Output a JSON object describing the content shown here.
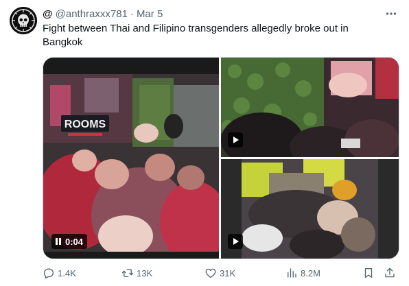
{
  "author": {
    "display_name": "@",
    "handle": "@anthraxxx781",
    "separator": "·",
    "date": "Mar 5"
  },
  "tweet": {
    "text": "Fight between Thai and Filipino transgenders allegedly broke out in Bangkok"
  },
  "media": {
    "main_video": {
      "duration": "0:04",
      "sign_text": "ROOMS"
    }
  },
  "actions": {
    "replies": "1.4K",
    "reposts": "13K",
    "likes": "31K",
    "views": "8.2M"
  },
  "icons": {
    "more": "more-horizontal-icon",
    "reply": "reply-icon",
    "repost": "repost-icon",
    "like": "heart-icon",
    "views": "bar-chart-icon",
    "bookmark": "bookmark-icon",
    "share": "share-icon"
  },
  "colors": {
    "text": "#0f1419",
    "muted": "#536471",
    "border": "#cfd9de"
  }
}
